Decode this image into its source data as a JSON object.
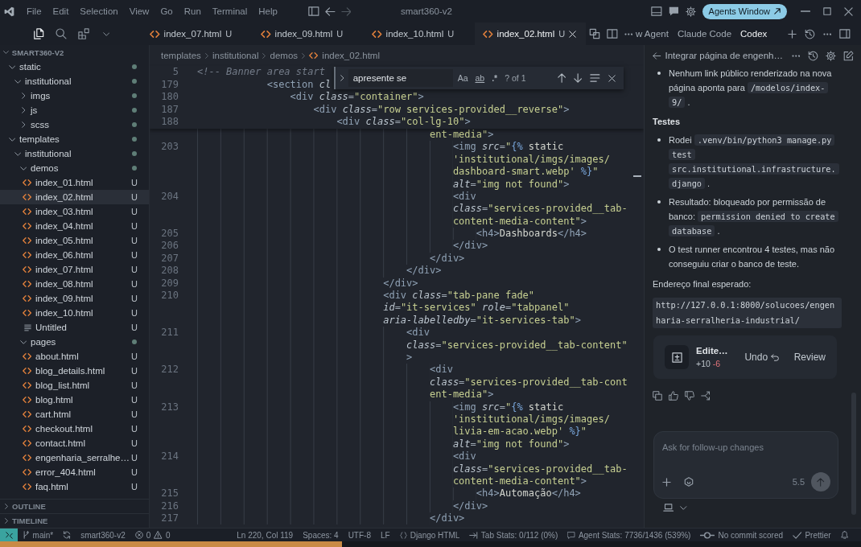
{
  "title_bar": {
    "menu": [
      "File",
      "Edit",
      "Selection",
      "View",
      "Go",
      "Run",
      "Terminal",
      "Help"
    ],
    "title": "smart360-v2",
    "agents_button": "Agents Window"
  },
  "sidebar": {
    "views": [
      {
        "kind": "explorer",
        "selected": true
      },
      {
        "kind": "search",
        "selected": false
      },
      {
        "kind": "extensions",
        "selected": false
      }
    ],
    "root": "SMART360-V2",
    "tree": [
      {
        "kind": "folder",
        "label": "static",
        "expanded": true,
        "changes": true,
        "selected": false,
        "children": [
          {
            "kind": "folder",
            "label": "institutional",
            "expanded": true,
            "changes": true,
            "selected": false,
            "children": [
              {
                "kind": "folder",
                "label": "imgs",
                "expanded": false,
                "changes": true,
                "selected": false
              },
              {
                "kind": "folder",
                "label": "js",
                "expanded": false,
                "changes": true,
                "selected": false
              },
              {
                "kind": "folder",
                "label": "scss",
                "expanded": false,
                "changes": true,
                "selected": false
              }
            ]
          }
        ]
      },
      {
        "kind": "folder",
        "label": "templates",
        "expanded": true,
        "changes": true,
        "selected": false,
        "children": [
          {
            "kind": "folder",
            "label": "institutional",
            "expanded": true,
            "changes": true,
            "selected": false,
            "children": [
              {
                "kind": "folder",
                "label": "demos",
                "expanded": true,
                "changes": true,
                "selected": false,
                "children": [
                  {
                    "kind": "html",
                    "label": "index_01.html",
                    "status": "U",
                    "selected": false
                  },
                  {
                    "kind": "html",
                    "label": "index_02.html",
                    "status": "U",
                    "selected": true
                  },
                  {
                    "kind": "html",
                    "label": "index_03.html",
                    "status": "U",
                    "selected": false
                  },
                  {
                    "kind": "html",
                    "label": "index_04.html",
                    "status": "U",
                    "selected": false
                  },
                  {
                    "kind": "html",
                    "label": "index_05.html",
                    "status": "U",
                    "selected": false
                  },
                  {
                    "kind": "html",
                    "label": "index_06.html",
                    "status": "U",
                    "selected": false
                  },
                  {
                    "kind": "html",
                    "label": "index_07.html",
                    "status": "U",
                    "selected": false
                  },
                  {
                    "kind": "html",
                    "label": "index_08.html",
                    "status": "U",
                    "selected": false
                  },
                  {
                    "kind": "html",
                    "label": "index_09.html",
                    "status": "U",
                    "selected": false
                  },
                  {
                    "kind": "html",
                    "label": "index_10.html",
                    "status": "U",
                    "selected": false
                  },
                  {
                    "kind": "text",
                    "label": "Untitled",
                    "status": "U",
                    "selected": false
                  }
                ]
              },
              {
                "kind": "folder",
                "label": "pages",
                "expanded": true,
                "changes": true,
                "selected": false,
                "children": [
                  {
                    "kind": "html",
                    "label": "about.html",
                    "status": "U",
                    "selected": false
                  },
                  {
                    "kind": "html",
                    "label": "blog_details.html",
                    "status": "U",
                    "selected": false
                  },
                  {
                    "kind": "html",
                    "label": "blog_list.html",
                    "status": "U",
                    "selected": false
                  },
                  {
                    "kind": "html",
                    "label": "blog.html",
                    "status": "U",
                    "selected": false
                  },
                  {
                    "kind": "html",
                    "label": "cart.html",
                    "status": "U",
                    "selected": false
                  },
                  {
                    "kind": "html",
                    "label": "checkout.html",
                    "status": "U",
                    "selected": false
                  },
                  {
                    "kind": "html",
                    "label": "contact.html",
                    "status": "U",
                    "selected": false
                  },
                  {
                    "kind": "html",
                    "label": "engenharia_serralhe…",
                    "status": "U",
                    "selected": false
                  },
                  {
                    "kind": "html",
                    "label": "error_404.html",
                    "status": "U",
                    "selected": false
                  },
                  {
                    "kind": "html",
                    "label": "faq.html",
                    "status": "U",
                    "selected": false
                  }
                ]
              }
            ]
          }
        ]
      }
    ],
    "sections": [
      {
        "label": "OUTLINE",
        "expanded": false
      },
      {
        "label": "TIMELINE",
        "expanded": false
      }
    ]
  },
  "tabs": [
    {
      "label": "index_07.html",
      "status": "U",
      "selected": false
    },
    {
      "label": "index_09.html",
      "status": "U",
      "selected": false
    },
    {
      "label": "index_10.html",
      "status": "U",
      "selected": false
    },
    {
      "label": "index_02.html",
      "status": "U",
      "selected": true
    }
  ],
  "editor": {
    "breadcrumb": [
      {
        "kind": "folder",
        "label": "templates"
      },
      {
        "kind": "folder",
        "label": "institutional"
      },
      {
        "kind": "folder",
        "label": "demos"
      },
      {
        "kind": "html",
        "label": "index_02.html"
      }
    ],
    "find": {
      "value": "apresente se",
      "options": [
        {
          "kind": "case",
          "label": "Aa",
          "selected": false
        },
        {
          "kind": "word",
          "label": "ab",
          "selected": false
        },
        {
          "kind": "regex",
          "label": ".*",
          "selected": false
        }
      ],
      "result": "? of 1"
    },
    "sticky": [
      {
        "number": "5",
        "wraps": [
          {
            "tokens": [
              {
                "kind": "cmt",
                "text": "<!-- Banner area start"
              }
            ]
          }
        ]
      },
      {
        "number": "179",
        "wraps": [
          {
            "tokens": [
              {
                "kind": "tag",
                "text": "            <section"
              },
              {
                "kind": "attr",
                "text": " cl"
              }
            ]
          }
        ]
      },
      {
        "number": "180",
        "wraps": [
          {
            "tokens": [
              {
                "kind": "tag",
                "text": "                <div"
              },
              {
                "kind": "attr",
                "text": " class"
              },
              {
                "kind": "punct",
                "text": "="
              },
              {
                "kind": "str",
                "text": "\"container\""
              },
              {
                "kind": "tag",
                "text": ">"
              }
            ]
          }
        ]
      },
      {
        "number": "187",
        "wraps": [
          {
            "tokens": [
              {
                "kind": "tag",
                "text": "                    <div"
              },
              {
                "kind": "attr",
                "text": " class"
              },
              {
                "kind": "punct",
                "text": "="
              },
              {
                "kind": "str",
                "text": "\"row services-provided__reverse\""
              },
              {
                "kind": "tag",
                "text": ">"
              }
            ]
          }
        ]
      },
      {
        "number": "188",
        "wraps": [
          {
            "tokens": [
              {
                "kind": "tag",
                "text": "                        <div"
              },
              {
                "kind": "attr",
                "text": " class"
              },
              {
                "kind": "punct",
                "text": "="
              },
              {
                "kind": "str",
                "text": "\"col-lg-10\""
              },
              {
                "kind": "tag",
                "text": ">"
              }
            ]
          }
        ]
      }
    ],
    "lines": [
      {
        "wraps": [
          {
            "tokens": [
              {
                "kind": "str",
                "text": "                                        ent-media\""
              },
              {
                "kind": "tag",
                "text": ">"
              }
            ]
          }
        ]
      },
      {
        "number": "203",
        "wraps": [
          {
            "tokens": [
              {
                "kind": "tag",
                "text": "                                            <img"
              },
              {
                "kind": "attr",
                "text": " src"
              },
              {
                "kind": "punct",
                "text": "="
              },
              {
                "kind": "str",
                "text": "\""
              },
              {
                "kind": "tpl",
                "text": "{%"
              },
              {
                "kind": "text",
                "text": " static"
              }
            ]
          },
          {
            "tokens": [
              {
                "kind": "str",
                "text": "                                            'institutional/imgs/images/"
              }
            ]
          },
          {
            "tokens": [
              {
                "kind": "str",
                "text": "                                            dashboard-smart.webp'"
              },
              {
                "kind": "tpl",
                "text": " %}"
              },
              {
                "kind": "str",
                "text": "\""
              }
            ]
          },
          {
            "tokens": [
              {
                "kind": "attr",
                "text": "                                            alt"
              },
              {
                "kind": "punct",
                "text": "="
              },
              {
                "kind": "str",
                "text": "\"img not found\""
              },
              {
                "kind": "tag",
                "text": ">"
              }
            ]
          }
        ]
      },
      {
        "number": "204",
        "wraps": [
          {
            "tokens": [
              {
                "kind": "tag",
                "text": "                                            <div"
              }
            ]
          },
          {
            "tokens": [
              {
                "kind": "attr",
                "text": "                                            class"
              },
              {
                "kind": "punct",
                "text": "="
              },
              {
                "kind": "str",
                "text": "\"services-provided__tab-"
              }
            ]
          },
          {
            "tokens": [
              {
                "kind": "str",
                "text": "                                            content-media-content\""
              },
              {
                "kind": "tag",
                "text": ">"
              }
            ]
          }
        ]
      },
      {
        "number": "205",
        "wraps": [
          {
            "tokens": [
              {
                "kind": "tag",
                "text": "                                                <h4>"
              },
              {
                "kind": "text",
                "text": "Dashboards"
              },
              {
                "kind": "tag",
                "text": "</h4>"
              }
            ]
          }
        ]
      },
      {
        "number": "206",
        "wraps": [
          {
            "tokens": [
              {
                "kind": "tag",
                "text": "                                            </div>"
              }
            ]
          }
        ]
      },
      {
        "number": "207",
        "wraps": [
          {
            "tokens": [
              {
                "kind": "tag",
                "text": "                                        </div>"
              }
            ]
          }
        ]
      },
      {
        "number": "208",
        "wraps": [
          {
            "tokens": [
              {
                "kind": "tag",
                "text": "                                    </div>"
              }
            ]
          }
        ]
      },
      {
        "number": "209",
        "wraps": [
          {
            "tokens": [
              {
                "kind": "tag",
                "text": "                                </div>"
              }
            ]
          }
        ]
      },
      {
        "number": "210",
        "wraps": [
          {
            "tokens": [
              {
                "kind": "tag",
                "text": "                                <div"
              },
              {
                "kind": "attr",
                "text": " class"
              },
              {
                "kind": "punct",
                "text": "="
              },
              {
                "kind": "str",
                "text": "\"tab-pane fade\""
              }
            ]
          },
          {
            "tokens": [
              {
                "kind": "attr",
                "text": "                                id"
              },
              {
                "kind": "punct",
                "text": "="
              },
              {
                "kind": "str",
                "text": "\"it-services\""
              },
              {
                "kind": "attr",
                "text": " role"
              },
              {
                "kind": "punct",
                "text": "="
              },
              {
                "kind": "str",
                "text": "\"tabpanel\""
              }
            ]
          },
          {
            "tokens": [
              {
                "kind": "attr",
                "text": "                                aria-labelledby"
              },
              {
                "kind": "punct",
                "text": "="
              },
              {
                "kind": "str",
                "text": "\"it-services-tab\""
              },
              {
                "kind": "tag",
                "text": ">"
              }
            ]
          }
        ]
      },
      {
        "number": "211",
        "wraps": [
          {
            "tokens": [
              {
                "kind": "tag",
                "text": "                                    <div"
              }
            ]
          },
          {
            "tokens": [
              {
                "kind": "attr",
                "text": "                                    class"
              },
              {
                "kind": "punct",
                "text": "="
              },
              {
                "kind": "str",
                "text": "\"services-provided__tab-content\""
              }
            ]
          },
          {
            "tokens": [
              {
                "kind": "tag",
                "text": "                                    >"
              }
            ]
          }
        ]
      },
      {
        "number": "212",
        "wraps": [
          {
            "tokens": [
              {
                "kind": "tag",
                "text": "                                        <div"
              }
            ]
          },
          {
            "tokens": [
              {
                "kind": "attr",
                "text": "                                        class"
              },
              {
                "kind": "punct",
                "text": "="
              },
              {
                "kind": "str",
                "text": "\"services-provided__tab-cont"
              }
            ]
          },
          {
            "tokens": [
              {
                "kind": "str",
                "text": "                                        ent-media\""
              },
              {
                "kind": "tag",
                "text": ">"
              }
            ]
          }
        ]
      },
      {
        "number": "213",
        "wraps": [
          {
            "tokens": [
              {
                "kind": "tag",
                "text": "                                            <img"
              },
              {
                "kind": "attr",
                "text": " src"
              },
              {
                "kind": "punct",
                "text": "="
              },
              {
                "kind": "str",
                "text": "\""
              },
              {
                "kind": "tpl",
                "text": "{%"
              },
              {
                "kind": "text",
                "text": " static"
              }
            ]
          },
          {
            "tokens": [
              {
                "kind": "str",
                "text": "                                            'institutional/imgs/images/"
              }
            ]
          },
          {
            "tokens": [
              {
                "kind": "str",
                "text": "                                            livia-em-acao.webp'"
              },
              {
                "kind": "tpl",
                "text": " %}"
              },
              {
                "kind": "str",
                "text": "\""
              }
            ]
          },
          {
            "tokens": [
              {
                "kind": "attr",
                "text": "                                            alt"
              },
              {
                "kind": "punct",
                "text": "="
              },
              {
                "kind": "str",
                "text": "\"img not found\""
              },
              {
                "kind": "tag",
                "text": ">"
              }
            ]
          }
        ]
      },
      {
        "number": "214",
        "wraps": [
          {
            "tokens": [
              {
                "kind": "tag",
                "text": "                                            <div"
              }
            ]
          },
          {
            "tokens": [
              {
                "kind": "attr",
                "text": "                                            class"
              },
              {
                "kind": "punct",
                "text": "="
              },
              {
                "kind": "str",
                "text": "\"services-provided__tab-"
              }
            ]
          },
          {
            "tokens": [
              {
                "kind": "str",
                "text": "                                            content-media-content\""
              },
              {
                "kind": "tag",
                "text": ">"
              }
            ]
          }
        ]
      },
      {
        "number": "215",
        "wraps": [
          {
            "tokens": [
              {
                "kind": "tag",
                "text": "                                                <h4>"
              },
              {
                "kind": "text",
                "text": "Automação"
              },
              {
                "kind": "tag",
                "text": "</h4>"
              }
            ]
          }
        ]
      },
      {
        "number": "216",
        "wraps": [
          {
            "tokens": [
              {
                "kind": "tag",
                "text": "                                            </div>"
              }
            ]
          }
        ]
      },
      {
        "number": "217",
        "wraps": [
          {
            "tokens": [
              {
                "kind": "tag",
                "text": "                                        </div>"
              }
            ]
          }
        ]
      }
    ]
  },
  "panel": {
    "tabs": [
      {
        "label": "w Agent",
        "selected": false
      },
      {
        "label": "Claude Code",
        "selected": false
      },
      {
        "label": "Codex",
        "selected": true
      }
    ],
    "thread_title": "Integrar página de engenh…",
    "blocks": [
      {
        "kind": "bullet",
        "parts": [
          {
            "kind": "text",
            "text": "Nenhum link público renderizado na nova página aponta para "
          },
          {
            "kind": "code",
            "text": "/modelos/index-9/"
          },
          {
            "kind": "text",
            "text": " ."
          }
        ]
      },
      {
        "kind": "heading",
        "text": "Testes"
      },
      {
        "kind": "bullet",
        "parts": [
          {
            "kind": "text",
            "text": "Rodei "
          },
          {
            "kind": "code",
            "text": ".venv/bin/python3 manage.py test src.institutional.infrastructure.django"
          },
          {
            "kind": "text",
            "text": " ."
          }
        ]
      },
      {
        "kind": "bullet",
        "parts": [
          {
            "kind": "text",
            "text": "Resultado: bloqueado por permissão de banco: "
          },
          {
            "kind": "code",
            "text": "permission denied to create database"
          },
          {
            "kind": "text",
            "text": " ."
          }
        ]
      },
      {
        "kind": "bullet",
        "parts": [
          {
            "kind": "text",
            "text": "O test runner encontrou 4 testes, mas não conseguiu criar o banco de teste."
          }
        ]
      },
      {
        "kind": "paragraph",
        "text": "Endereço final esperado:"
      },
      {
        "kind": "code_block",
        "text": "http://127.0.0.1:8000/solucoes/engenharia-serralheria-industrial/"
      }
    ],
    "edit_card": {
      "title": "Edite…",
      "added": "+10",
      "removed": "-6",
      "undo": "Undo",
      "review": "Review"
    },
    "composer": {
      "placeholder": "Ask for follow-up changes",
      "model": "5.5",
      "send_disabled": true
    }
  },
  "status_bar": {
    "left": [
      {
        "kind": "remote"
      },
      {
        "kind": "branch",
        "text": "main*"
      },
      {
        "kind": "sync"
      },
      {
        "kind": "plain",
        "text": "smart360-v2"
      },
      {
        "kind": "problems",
        "errors": "0",
        "warnings": "0"
      }
    ],
    "right": [
      {
        "kind": "plain",
        "text": "Ln 220, Col 119"
      },
      {
        "kind": "plain",
        "text": "Spaces: 4"
      },
      {
        "kind": "plain",
        "text": "UTF-8"
      },
      {
        "kind": "plain",
        "text": "LF"
      },
      {
        "kind": "language",
        "text": "Django HTML"
      },
      {
        "kind": "tab_stats",
        "text": "Tab Stats: 0/112 (0%)"
      },
      {
        "kind": "agent_stats",
        "text": "Agent Stats: 7736/1436 (539%)"
      },
      {
        "kind": "commit",
        "text": "No commit scored"
      },
      {
        "kind": "prettier",
        "text": "Prettier"
      },
      {
        "kind": "bell"
      }
    ]
  }
}
